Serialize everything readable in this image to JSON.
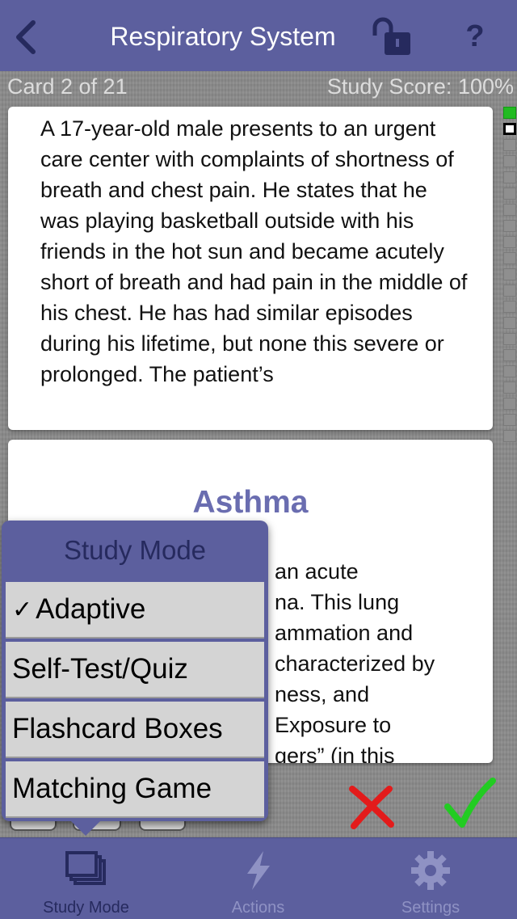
{
  "navbar": {
    "title": "Respiratory System",
    "back_icon": "chevron-left-icon",
    "lock_icon": "unlock-icon",
    "help_label": "?"
  },
  "status": {
    "card_counter": "Card 2 of 21",
    "study_score": "Study Score: 100%"
  },
  "question_card": {
    "text": "A 17-year-old male presents to an urgent care center with complaints of shortness of breath and chest pain. He states that he was playing basketball outside with his friends in the hot sun and became acutely short of breath and had pain in the middle of his chest. He has had similar episodes during his lifetime, but none this severe or prolonged. The patient’s"
  },
  "answer_card": {
    "title": "Asthma",
    "text": "an acute\nna. This lung\nammation and\ncharacterized by\nness, and\nExposure to\ngers” (in this"
  },
  "popover": {
    "title": "Study Mode",
    "items": [
      {
        "label": "Adaptive",
        "checked": true,
        "check": "✓"
      },
      {
        "label": "Self-Test/Quiz",
        "checked": false
      },
      {
        "label": "Flashcard Boxes",
        "checked": false
      },
      {
        "label": "Matching Game",
        "checked": false
      }
    ]
  },
  "actions": {
    "incorrect_icon": "x-mark-icon",
    "correct_icon": "checkmark-icon"
  },
  "tabbar": {
    "tabs": [
      {
        "label": "Study Mode",
        "icon": "stacked-cards-icon",
        "active": true
      },
      {
        "label": "Actions",
        "icon": "lightning-icon",
        "active": false
      },
      {
        "label": "Settings",
        "icon": "gear-icon",
        "active": false
      }
    ]
  },
  "colors": {
    "bar_background": "#5c5f9e",
    "answer_title": "#6a6db0",
    "incorrect": "#e31b1b",
    "correct": "#22cc22",
    "tab_active": "#262a5e",
    "tab_inactive": "#8f92c4"
  }
}
